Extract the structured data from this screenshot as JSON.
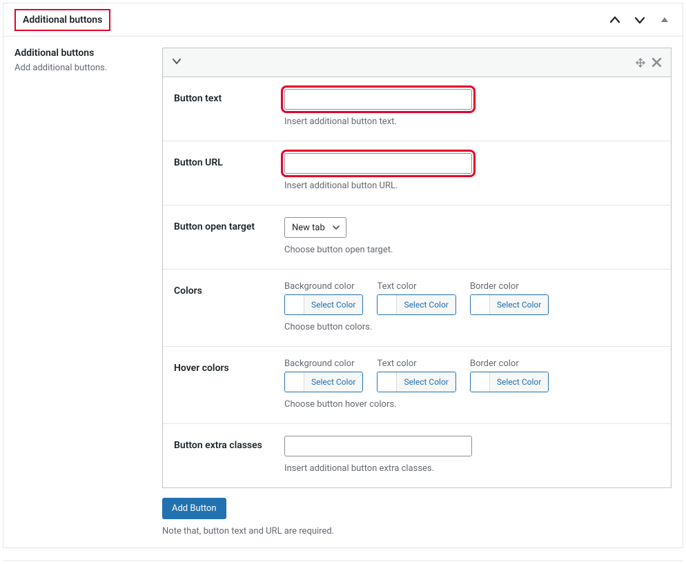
{
  "header": {
    "title": "Additional buttons"
  },
  "sidebar": {
    "title": "Additional buttons",
    "desc": "Add additional buttons."
  },
  "fields": {
    "button_text": {
      "label": "Button text",
      "value": "",
      "hint": "Insert additional button text."
    },
    "button_url": {
      "label": "Button URL",
      "value": "",
      "hint": "Insert additional button URL."
    },
    "open_target": {
      "label": "Button open target",
      "selected": "New tab",
      "hint": "Choose button open target."
    },
    "colors": {
      "label": "Colors",
      "items": {
        "bg": "Background color",
        "text": "Text color",
        "border": "Border color"
      },
      "select_label": "Select Color",
      "hint": "Choose button colors."
    },
    "hover_colors": {
      "label": "Hover colors",
      "items": {
        "bg": "Background color",
        "text": "Text color",
        "border": "Border color"
      },
      "select_label": "Select Color",
      "hint": "Choose button hover colors."
    },
    "extra_classes": {
      "label": "Button extra classes",
      "value": "",
      "hint": "Insert additional button extra classes."
    }
  },
  "footer": {
    "add_button": "Add Button",
    "note": "Note that, button text and URL are required."
  }
}
